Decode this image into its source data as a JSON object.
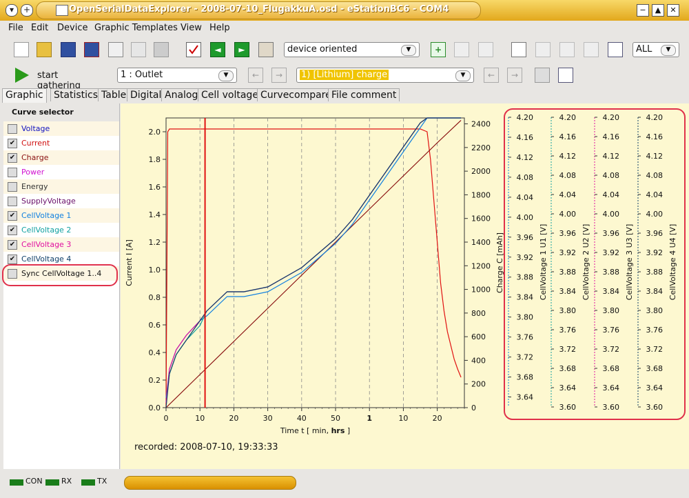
{
  "window": {
    "title": "OpenSerialDataExplorer  -  2008-07-10_FlugakkuA.osd  -  eStationBC6  -  COM4"
  },
  "menu": [
    "File",
    "Edit",
    "Device",
    "Graphic Templates",
    "View",
    "Help"
  ],
  "toolbar": {
    "layout_combo": "device oriented",
    "filter_combo": "ALL",
    "start_label": "start gathering",
    "outlet_combo": "1 : Outlet",
    "record_combo": "1) [Lithium] charge"
  },
  "tabs": [
    "Graphic",
    "Statistics",
    "Table",
    "Digital",
    "Analog",
    "Cell voltage",
    "Curvecompare",
    "File comment"
  ],
  "sidebar": {
    "header": "Curve selector",
    "items": [
      {
        "label": "Voltage",
        "checked": false,
        "color": "#1010c0"
      },
      {
        "label": "Current",
        "checked": true,
        "color": "#d01010"
      },
      {
        "label": "Charge",
        "checked": true,
        "color": "#8a1010"
      },
      {
        "label": "Power",
        "checked": false,
        "color": "#d010d0"
      },
      {
        "label": "Energy",
        "checked": false,
        "color": "#333333"
      },
      {
        "label": "SupplyVoltage",
        "checked": false,
        "color": "#6a106a"
      },
      {
        "label": "CellVoltage 1",
        "checked": true,
        "color": "#1080e0"
      },
      {
        "label": "CellVoltage 2",
        "checked": true,
        "color": "#10a0a0"
      },
      {
        "label": "CellVoltage 3",
        "checked": true,
        "color": "#e010a0"
      },
      {
        "label": "CellVoltage 4",
        "checked": true,
        "color": "#10406a"
      },
      {
        "label": "Sync CellVoltage 1..4",
        "checked": false,
        "color": "#111111"
      }
    ]
  },
  "recorded": "recorded: 2008-07-10, 19:33:33",
  "status": {
    "con": "CON",
    "rx": "RX",
    "tx": "TX"
  },
  "chart_data": {
    "type": "line",
    "xlabel_prefix": "Time   t   [ min, ",
    "xlabel_bold": "hrs",
    "xlabel_suffix": " ]",
    "x_ticks": [
      "0",
      "10",
      "20",
      "30",
      "40",
      "50",
      "1",
      "10",
      "20"
    ],
    "x_tick_bold_index": 6,
    "xlim_minutes": [
      0,
      88
    ],
    "y_left": {
      "label": "Current   I   [A]",
      "ylim": [
        0,
        2.1
      ],
      "ticks": [
        "0.0",
        "0.2",
        "0.4",
        "0.6",
        "0.8",
        "1.0",
        "1.2",
        "1.4",
        "1.6",
        "1.8",
        "2.0"
      ]
    },
    "y_right": {
      "label": "Charge   C   [mAh]",
      "ylim": [
        0,
        2450
      ],
      "ticks": [
        "0",
        "200",
        "400",
        "600",
        "800",
        "1000",
        "1200",
        "1400",
        "1600",
        "1800",
        "2000",
        "2200",
        "2400"
      ]
    },
    "cell_axes": [
      {
        "label": "CellVoltage 1   U1   [V]",
        "ticks": [
          "4.20",
          "4.16",
          "4.12",
          "4.08",
          "4.04",
          "4.00",
          "3.96",
          "3.92",
          "3.88",
          "3.84",
          "3.80",
          "3.76",
          "3.72",
          "3.68",
          "3.64"
        ],
        "ylim": [
          3.62,
          4.2
        ],
        "color": "#1080e0"
      },
      {
        "label": "CellVoltage 2   U2   [V]",
        "ticks": [
          "4.20",
          "4.16",
          "4.12",
          "4.08",
          "4.04",
          "4.00",
          "3.96",
          "3.92",
          "3.88",
          "3.84",
          "3.80",
          "3.76",
          "3.72",
          "3.68",
          "3.64",
          "3.60"
        ],
        "ylim": [
          3.6,
          4.2
        ],
        "color": "#10a0a0"
      },
      {
        "label": "CellVoltage 3   U3   [V]",
        "ticks": [
          "4.20",
          "4.16",
          "4.12",
          "4.08",
          "4.04",
          "4.00",
          "3.96",
          "3.92",
          "3.88",
          "3.84",
          "3.80",
          "3.76",
          "3.72",
          "3.68",
          "3.64",
          "3.60"
        ],
        "ylim": [
          3.6,
          4.2
        ],
        "color": "#e010a0"
      },
      {
        "label": "CellVoltage 4   U4   [V]",
        "ticks": [
          "4.20",
          "4.16",
          "4.12",
          "4.08",
          "4.04",
          "4.00",
          "3.96",
          "3.92",
          "3.88",
          "3.84",
          "3.80",
          "3.76",
          "3.72",
          "3.68",
          "3.64",
          "3.60"
        ],
        "ylim": [
          3.6,
          4.2
        ],
        "color": "#10406a"
      }
    ],
    "series": [
      {
        "name": "Current",
        "axis": "current",
        "color": "#e01010",
        "x": [
          0,
          0.5,
          1,
          20,
          75,
          77,
          78,
          79,
          80,
          81,
          82,
          83,
          84,
          85,
          86,
          87
        ],
        "y": [
          0.0,
          2.0,
          2.02,
          2.02,
          2.02,
          2.0,
          1.8,
          1.5,
          1.2,
          0.9,
          0.7,
          0.55,
          0.45,
          0.35,
          0.28,
          0.22
        ]
      },
      {
        "name": "Charge",
        "axis": "charge",
        "color": "#8a1010",
        "x": [
          0,
          10,
          20,
          30,
          40,
          50,
          60,
          70,
          80,
          87
        ],
        "y": [
          0,
          280,
          560,
          840,
          1120,
          1400,
          1680,
          1960,
          2240,
          2430
        ]
      },
      {
        "name": "CellVoltage 1",
        "axis": "cell",
        "color": "#1080e0",
        "x": [
          0,
          1,
          3,
          6,
          10,
          12,
          18,
          23,
          30,
          35,
          40,
          45,
          50,
          55,
          60,
          65,
          70,
          75,
          77,
          87
        ],
        "y": [
          3.62,
          3.68,
          3.72,
          3.75,
          3.78,
          3.79,
          3.83,
          3.83,
          3.84,
          3.86,
          3.88,
          3.91,
          3.94,
          3.98,
          4.03,
          4.08,
          4.13,
          4.18,
          4.2,
          4.2
        ]
      },
      {
        "name": "CellVoltage 2",
        "axis": "cell",
        "color": "#10a0a0",
        "x": [
          0,
          1,
          3,
          6,
          10,
          12,
          18,
          23,
          30,
          35,
          40,
          45,
          50,
          55,
          60,
          65,
          70,
          75,
          77,
          87
        ],
        "y": [
          3.61,
          3.67,
          3.71,
          3.74,
          3.77,
          3.8,
          3.84,
          3.84,
          3.85,
          3.87,
          3.89,
          3.92,
          3.95,
          3.99,
          4.04,
          4.09,
          4.14,
          4.19,
          4.2,
          4.2
        ]
      },
      {
        "name": "CellVoltage 3",
        "axis": "cell",
        "color": "#e010a0",
        "x": [
          0,
          1,
          3,
          6,
          10,
          12,
          18,
          23,
          30,
          35,
          40,
          45,
          50,
          55,
          60,
          65,
          70,
          75,
          77,
          87
        ],
        "y": [
          3.61,
          3.68,
          3.72,
          3.75,
          3.78,
          3.8,
          3.84,
          3.84,
          3.85,
          3.87,
          3.89,
          3.92,
          3.95,
          3.99,
          4.04,
          4.09,
          4.14,
          4.19,
          4.2,
          4.2
        ]
      },
      {
        "name": "CellVoltage 4",
        "axis": "cell",
        "color": "#10406a",
        "x": [
          0,
          1,
          3,
          6,
          10,
          12,
          18,
          23,
          30,
          35,
          40,
          45,
          50,
          55,
          60,
          65,
          70,
          75,
          77,
          87
        ],
        "y": [
          3.6,
          3.67,
          3.71,
          3.74,
          3.78,
          3.8,
          3.84,
          3.84,
          3.85,
          3.87,
          3.89,
          3.92,
          3.95,
          3.99,
          4.04,
          4.09,
          4.14,
          4.19,
          4.2,
          4.2
        ]
      }
    ],
    "cursor_x_minutes": 11.5,
    "grid": "vertical-dashed",
    "highlight_color": "#e0304a"
  }
}
